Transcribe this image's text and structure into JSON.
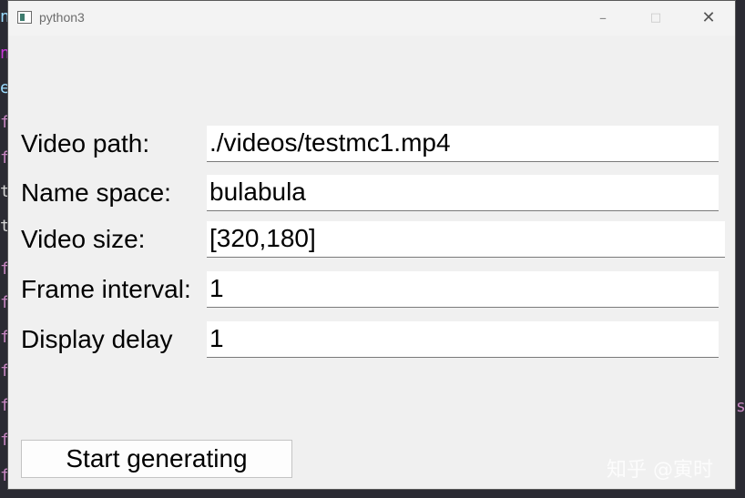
{
  "background": {
    "editor_chars": [
      "n",
      "n",
      "e",
      "f",
      "f",
      "t",
      "t",
      "f",
      "f",
      "f",
      "f",
      "f",
      "f",
      "f"
    ],
    "right_char": "s"
  },
  "window": {
    "title": "python3",
    "controls": {
      "minimize": "–",
      "maximize": "□",
      "close": "✕"
    }
  },
  "form": {
    "fields": [
      {
        "label": "Video path:",
        "value": "./videos/testmc1.mp4"
      },
      {
        "label": "Name space:",
        "value": "bulabula"
      },
      {
        "label": "Video size:",
        "value": "[320,180]"
      },
      {
        "label": "Frame interval:",
        "value": "1"
      },
      {
        "label": "Display delay",
        "value": "1"
      }
    ],
    "start_button": "Start generating"
  },
  "watermark": "知乎 @寅时",
  "colors": {
    "window_bg": "#f0f0f0",
    "field_bg": "#ffffff",
    "editor_bg": "#2b2b33",
    "editor_text": "#c586c0"
  }
}
